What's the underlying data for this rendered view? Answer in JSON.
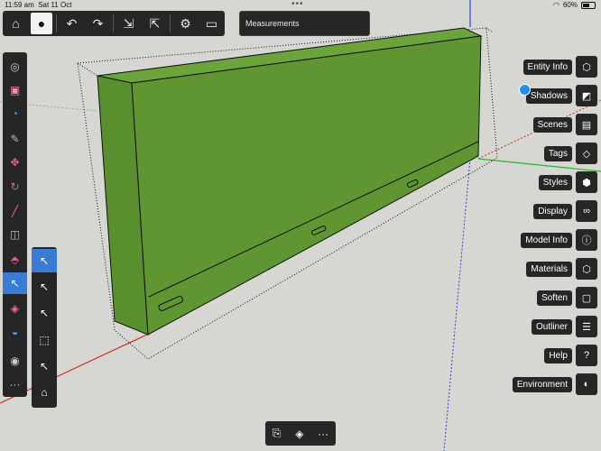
{
  "status": {
    "time": "11:59 am",
    "date": "Sat 11 Oct",
    "battery": "60%"
  },
  "toolbar": {
    "buttons": [
      "home-icon",
      "user-icon",
      "undo-icon",
      "redo-icon",
      "import-icon",
      "export-icon",
      "settings-icon",
      "print-icon"
    ]
  },
  "measurements": {
    "label": "Measurements"
  },
  "left_tools": [
    "gear-circle-icon",
    "paint-icon",
    "orbit-icon",
    "tape-icon",
    "move-icon",
    "rotate-icon",
    "pencil-icon",
    "rectangle-icon",
    "pushpull-icon",
    "select-icon",
    "eraser-icon",
    "paintbucket-icon",
    "camera-icon",
    "more-icon"
  ],
  "sub_tools": [
    "select-add-icon",
    "select-minus-icon",
    "select-toggle-icon",
    "select-box-icon",
    "select-deselect-icon",
    "select-more-icon"
  ],
  "panels": [
    {
      "label": "Entity Info",
      "icon": "cube-icon"
    },
    {
      "label": "Shadows",
      "icon": "shadow-icon"
    },
    {
      "label": "Scenes",
      "icon": "scenes-icon"
    },
    {
      "label": "Tags",
      "icon": "tag-icon"
    },
    {
      "label": "Styles",
      "icon": "styles-icon"
    },
    {
      "label": "Display",
      "icon": "glasses-icon"
    },
    {
      "label": "Model Info",
      "icon": "info-icon"
    },
    {
      "label": "Materials",
      "icon": "materials-icon"
    },
    {
      "label": "Soften",
      "icon": "soften-icon"
    },
    {
      "label": "Outliner",
      "icon": "outliner-icon"
    },
    {
      "label": "Help",
      "icon": "help-icon"
    },
    {
      "label": "Environment",
      "icon": "environment-icon"
    }
  ],
  "bottom": [
    "clipboard-icon",
    "layers-icon",
    "more-icon"
  ],
  "colors": {
    "model": "#5a8f2e",
    "toolbar": "#262626",
    "accent": "#3a7bd5"
  }
}
